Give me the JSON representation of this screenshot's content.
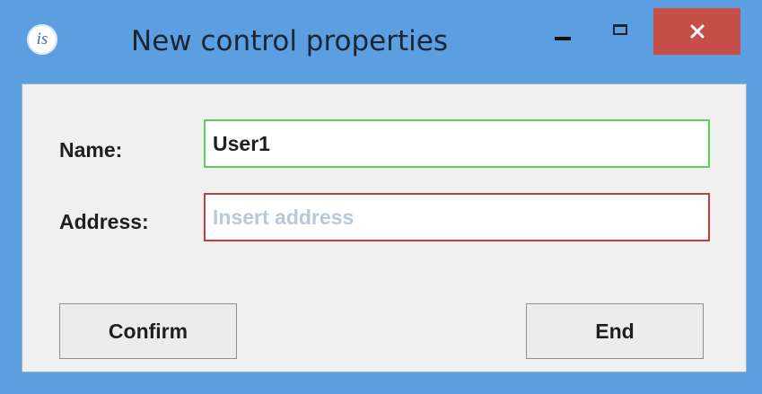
{
  "window": {
    "title": "New control properties",
    "app_icon": {
      "name": "is-app-icon",
      "text": "is"
    },
    "controls": {
      "minimize": "minimize-icon",
      "maximize": "maximize-icon",
      "close": "close-icon"
    },
    "colors": {
      "frame": "#5b9fe0",
      "close_button": "#c74f4a",
      "client_bg": "#f0f0f0"
    }
  },
  "form": {
    "name_label": "Name:",
    "name_value": "User1",
    "address_label": "Address:",
    "address_value": "",
    "address_placeholder": "Insert address",
    "colors": {
      "valid_border": "#5bd15b",
      "invalid_border": "#c93a3a"
    }
  },
  "buttons": {
    "confirm_label": "Confirm",
    "end_label": "End"
  }
}
